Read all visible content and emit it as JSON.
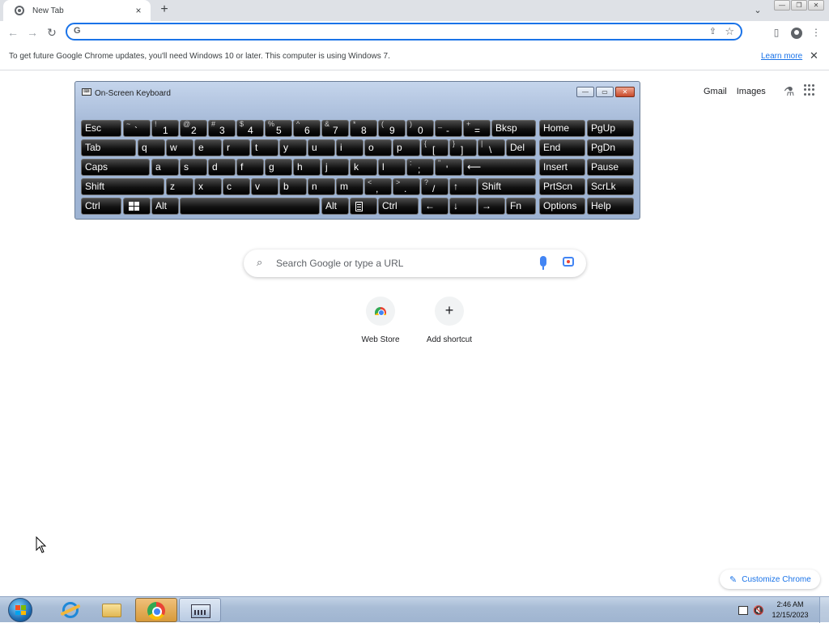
{
  "browser": {
    "tab": {
      "title": "New Tab",
      "close": "×"
    },
    "new_tab_button": "+",
    "tab_search": "⌄",
    "window_controls": [
      "—",
      "❐",
      "✕"
    ],
    "nav": {
      "back": "←",
      "forward": "→",
      "reload": "↻"
    },
    "omnibox": {
      "value": "",
      "icon": "G",
      "share": "⇪",
      "star": "☆"
    },
    "side_panel_icon": "▯",
    "menu_icon": "⋮"
  },
  "infobar": {
    "message": "To get future Google Chrome updates, you'll need Windows 10 or later. This computer is using Windows 7.",
    "link": "Learn more",
    "close": "✕"
  },
  "ntp": {
    "top_links": [
      "Gmail",
      "Images"
    ],
    "labs_icon": "⚗",
    "search_placeholder": "Search Google or type a URL",
    "search_icon": "⌕",
    "shortcuts": [
      {
        "label": "Web Store"
      },
      {
        "label": "Add shortcut",
        "symbol": "+"
      }
    ],
    "customize_label": "Customize Chrome",
    "customize_icon": "✎"
  },
  "osk": {
    "title": "On-Screen Keyboard",
    "title_icon": "⌨",
    "controls": [
      "—",
      "▭",
      "✕"
    ],
    "rows": [
      [
        "Esc",
        [
          "~",
          "`"
        ],
        [
          "!",
          "1"
        ],
        [
          "@",
          "2"
        ],
        [
          "#",
          "3"
        ],
        [
          "$",
          "4"
        ],
        [
          "%",
          "5"
        ],
        [
          "^",
          "6"
        ],
        [
          "&",
          "7"
        ],
        [
          "*",
          "8"
        ],
        [
          "(",
          "9"
        ],
        [
          ")",
          "0"
        ],
        [
          "_",
          "-"
        ],
        [
          "+",
          "="
        ],
        "Bksp",
        "Home",
        "PgUp"
      ],
      [
        "Tab",
        "q",
        "w",
        "e",
        "r",
        "t",
        "y",
        "u",
        "i",
        "o",
        "p",
        [
          "{",
          "["
        ],
        [
          "}",
          "]"
        ],
        [
          "|",
          "\\"
        ],
        "Del",
        "End",
        "PgDn"
      ],
      [
        "Caps",
        "a",
        "s",
        "d",
        "f",
        "g",
        "h",
        "j",
        "k",
        "l",
        [
          ":",
          ";"
        ],
        [
          "\"",
          "'"
        ],
        "⟵",
        "Insert",
        "Pause"
      ],
      [
        "Shift",
        "z",
        "x",
        "c",
        "v",
        "b",
        "n",
        "m",
        [
          "<",
          ","
        ],
        [
          ">",
          "."
        ],
        [
          "?",
          "/"
        ],
        "↑",
        "Shift",
        "PrtScn",
        "ScrLk"
      ],
      [
        "Ctrl",
        "Win",
        "Alt",
        "",
        "Alt",
        "Menu",
        "Ctrl",
        "←",
        "↓",
        "→",
        "Fn",
        "Options",
        "Help"
      ]
    ]
  },
  "taskbar": {
    "apps": [
      "start",
      "internet-explorer",
      "file-explorer",
      "chrome",
      "on-screen-keyboard"
    ],
    "tray_speaker": "🔇",
    "time": "2:46 AM",
    "date": "12/15/2023"
  }
}
